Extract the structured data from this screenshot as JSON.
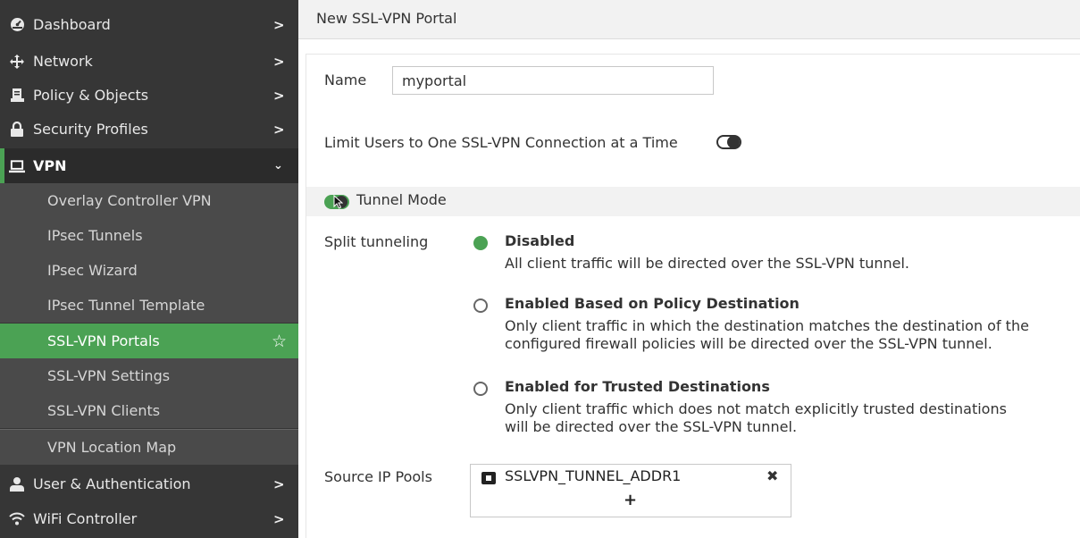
{
  "sidebar": {
    "items": [
      {
        "label": "Dashboard",
        "icon": "dashboard-icon"
      },
      {
        "label": "Network",
        "icon": "network-icon"
      },
      {
        "label": "Policy & Objects",
        "icon": "policy-icon"
      },
      {
        "label": "Security Profiles",
        "icon": "lock-icon"
      },
      {
        "label": "VPN",
        "icon": "laptop-icon"
      },
      {
        "label": "User & Authentication",
        "icon": "user-icon"
      },
      {
        "label": "WiFi Controller",
        "icon": "wifi-icon"
      }
    ],
    "vpn_subitems": [
      {
        "label": "Overlay Controller VPN"
      },
      {
        "label": "IPsec Tunnels"
      },
      {
        "label": "IPsec Wizard"
      },
      {
        "label": "IPsec Tunnel Template"
      },
      {
        "label": "SSL-VPN Portals",
        "active": true
      },
      {
        "label": "SSL-VPN Settings"
      },
      {
        "label": "SSL-VPN Clients"
      },
      {
        "label": "VPN Location Map"
      }
    ]
  },
  "main": {
    "title": "New SSL-VPN Portal",
    "name_label": "Name",
    "name_value": "myportal",
    "limit_users_label": "Limit Users to One SSL-VPN Connection at a Time",
    "tunnel_mode_label": "Tunnel Mode",
    "split_tunneling_label": "Split tunneling",
    "split_options": [
      {
        "title": "Disabled",
        "desc": [
          "All client traffic will be directed over the SSL-VPN tunnel."
        ],
        "selected": true
      },
      {
        "title": "Enabled Based on Policy Destination",
        "desc": [
          "Only client traffic in which the destination matches the destination of the",
          "configured firewall policies will be directed over the SSL-VPN tunnel."
        ],
        "selected": false
      },
      {
        "title": "Enabled for Trusted Destinations",
        "desc": [
          "Only client traffic which does not match explicitly trusted destinations",
          "will be directed over the SSL-VPN tunnel."
        ],
        "selected": false
      }
    ],
    "source_ip_pools_label": "Source IP Pools",
    "source_ip_pool": "SSLVPN_TUNNEL_ADDR1",
    "remove_glyph": "✖",
    "add_glyph": "+"
  },
  "colors": {
    "sidebar_bg": "#363636",
    "accent": "#4ba254"
  }
}
